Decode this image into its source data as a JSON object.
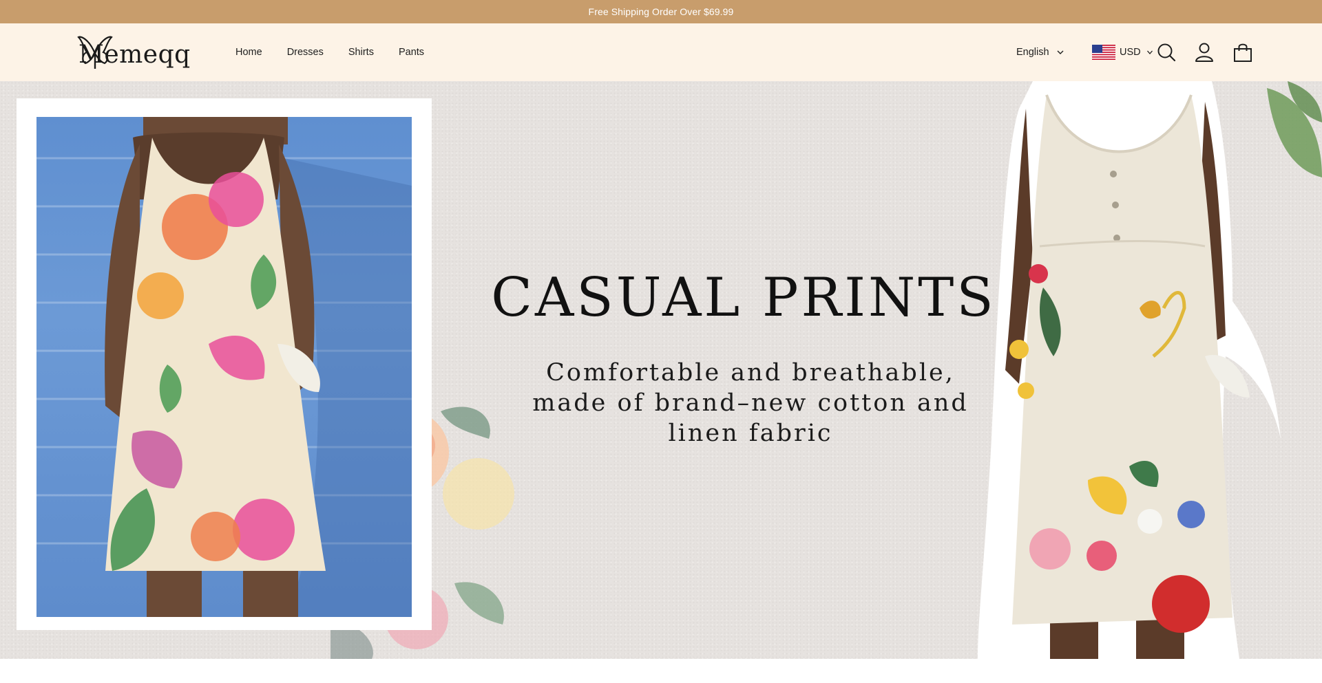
{
  "announcement": {
    "text": "Free Shipping Order Over $69.99"
  },
  "header": {
    "logo_text": "Memeqq",
    "nav": [
      {
        "label": "Home"
      },
      {
        "label": "Dresses"
      },
      {
        "label": "Shirts"
      },
      {
        "label": "Pants"
      }
    ],
    "language": {
      "selected": "English"
    },
    "currency": {
      "selected": "USD",
      "flag": "us-flag-icon"
    },
    "icons": [
      "search-icon",
      "account-icon",
      "cart-icon"
    ]
  },
  "hero": {
    "headline": "CASUAL PRINTS",
    "subline": "Comfortable and breathable, made of brand–new cotton and linen fabric"
  },
  "colors": {
    "announcement_bg": "#c89d6c",
    "header_bg": "#fdf3e7",
    "hero_bg": "#e6e2df",
    "text_dark": "#1e1e1e"
  }
}
